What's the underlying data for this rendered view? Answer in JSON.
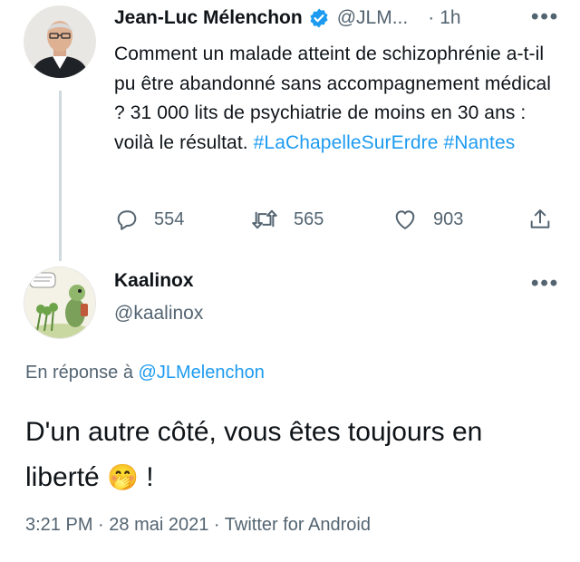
{
  "tweet": {
    "author_name": "Jean-Luc Mélenchon",
    "author_handle": "@JLM...",
    "separator": "·",
    "time": "1h",
    "text_plain": "Comment un malade atteint de schizophrénie a-t-il pu être abandonné sans accompagnement médical ? 31 000 lits de psychiatrie de moins en 30 ans : voilà le résultat.",
    "hashtag_1": "#LaChapelleSurErdre",
    "hashtag_2": "#Nantes",
    "replies": "554",
    "retweets": "565",
    "likes": "903",
    "more_label": "•••"
  },
  "reply": {
    "author_name": "Kaalinox",
    "author_handle": "@kaalinox",
    "more_label": "•••",
    "in_reply_prefix": "En réponse à",
    "in_reply_mention": "@JLMelenchon",
    "text": "D'un autre côté, vous êtes toujours en liberté",
    "emoji": "🤭",
    "text_end": "!",
    "timestamp": "3:21 PM",
    "date": "28 mai 2021",
    "source": "Twitter for Android",
    "meta_separator": "·"
  },
  "colors": {
    "accent": "#1d9bf0",
    "verified": "#1d9bf0",
    "muted": "#536471",
    "text": "#0f1419"
  }
}
